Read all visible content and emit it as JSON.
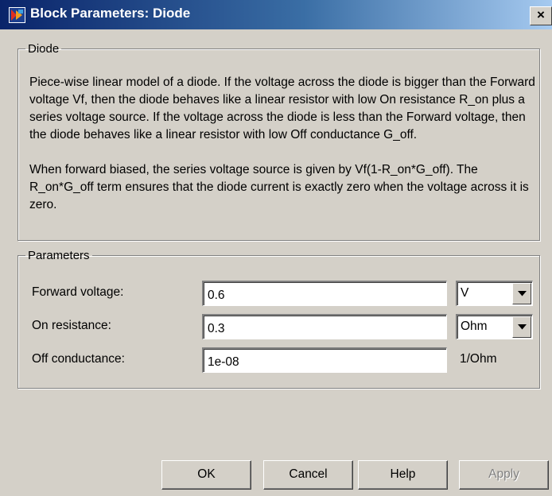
{
  "window": {
    "title": "Block Parameters: Diode",
    "close_glyph": "×"
  },
  "diode_group": {
    "legend": "Diode",
    "paragraphs": [
      "Piece-wise linear model of a diode. If the voltage across the diode is bigger than the Forward voltage Vf, then the diode behaves like a linear resistor with low On resistance R_on plus a series voltage source. If the voltage across the diode is less than the Forward voltage, then the diode behaves like a linear resistor with low Off conductance G_off.",
      "When forward biased, the series voltage source is given by Vf(1-R_on*G_off). The R_on*G_off term ensures that the diode current is exactly zero when the voltage across it is zero."
    ]
  },
  "parameters_group": {
    "legend": "Parameters",
    "rows": [
      {
        "label": "Forward voltage:",
        "value": "0.6",
        "unit": "V",
        "unit_is_dropdown": true
      },
      {
        "label": "On resistance:",
        "value": "0.3",
        "unit": "Ohm",
        "unit_is_dropdown": true
      },
      {
        "label": "Off conductance:",
        "value": "1e-08",
        "unit": "1/Ohm",
        "unit_is_dropdown": false
      }
    ]
  },
  "buttons": {
    "ok": "OK",
    "cancel": "Cancel",
    "help": "Help",
    "apply": "Apply"
  },
  "icons": {
    "title_icon": "simulink-block-icon",
    "dropdown_arrow": "chevron-down-icon"
  },
  "colors": {
    "title_gradient_start": "#0a246a",
    "title_gradient_end": "#a6caf0",
    "dialog_background": "#d4d0c8",
    "disabled_text": "#808080"
  }
}
